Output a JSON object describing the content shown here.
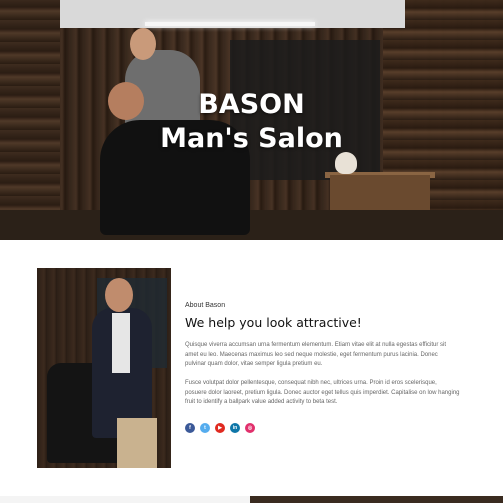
{
  "hero": {
    "title_line1": "BASON",
    "title_line2": "Man's Salon",
    "background": "barbershop-photo"
  },
  "about": {
    "kicker": "About Bason",
    "heading": "We help you look attractive!",
    "paragraph1": "Quisque viverra accumsan urna fermentum elementum. Etiam vitae elit at nulla egestas efficitur sit amet eu leo. Maecenas maximus leo sed neque molestie, eget fermentum purus lacinia. Donec pulvinar quam dolor, vitae semper ligula pretium eu.",
    "paragraph2": "Fusce volutpat dolor pellentesque, consequat nibh nec, ultrices urna. Proin id eros scelerisque, posuere dolor laoreet, pretium ligula. Donec auctor eget tellus quis imperdiet. Capitalise on low hanging fruit to identify a ballpark value added activity to beta test.",
    "social": [
      {
        "icon": "facebook-icon",
        "glyph": "f",
        "color": "#3b5998"
      },
      {
        "icon": "twitter-icon",
        "glyph": "t",
        "color": "#55acee"
      },
      {
        "icon": "youtube-icon",
        "glyph": "▶",
        "color": "#e02a20"
      },
      {
        "icon": "linkedin-icon",
        "glyph": "in",
        "color": "#0e76a8"
      },
      {
        "icon": "instagram-icon",
        "glyph": "◎",
        "color": "#e1306c"
      }
    ]
  }
}
